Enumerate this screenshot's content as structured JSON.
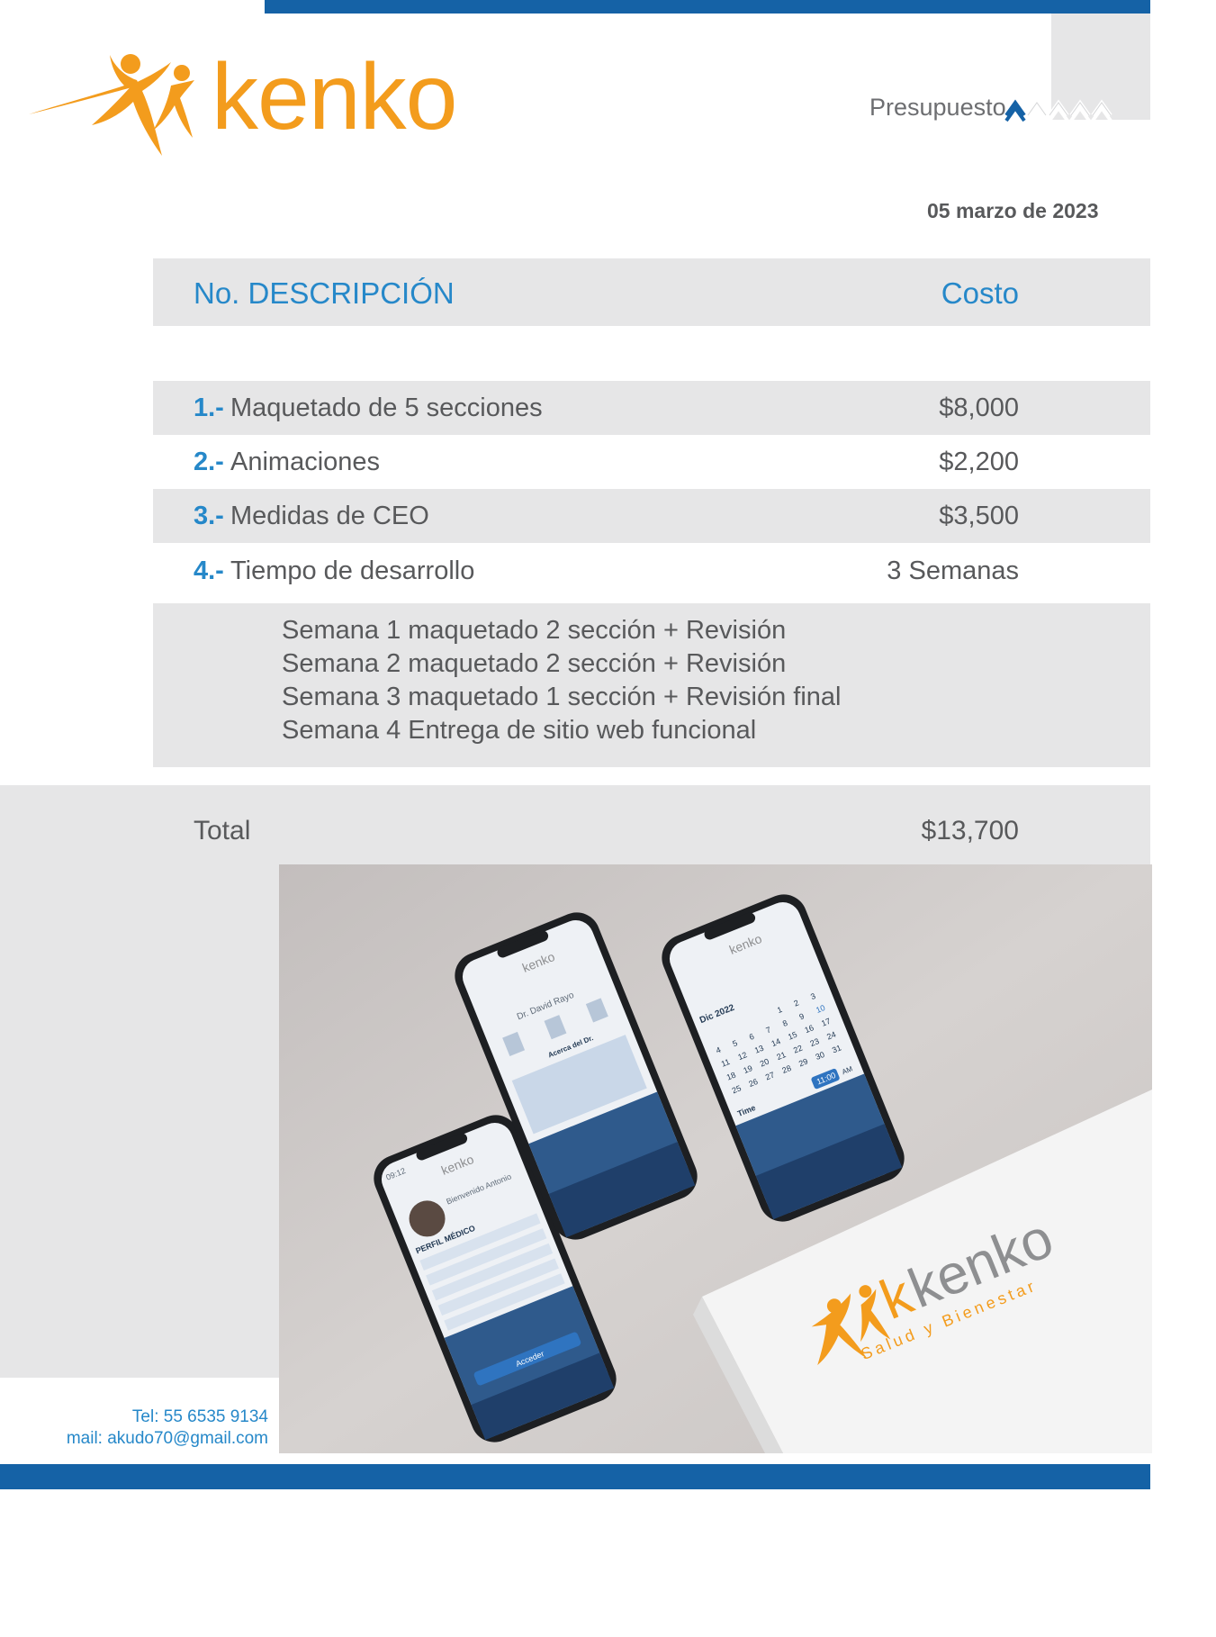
{
  "brand": {
    "name": "kenko",
    "colors": {
      "orange": "#f39c1d",
      "gray": "#8e8f91",
      "blue": "#1562a6",
      "light_blue": "#2688c9",
      "band": "#e6e6e7"
    }
  },
  "document": {
    "type_label": "Presupuesto",
    "date": "05 marzo de 2023"
  },
  "table": {
    "header_description": "No. DESCRIPCIÓN",
    "header_cost": "Costo",
    "rows": [
      {
        "num": "1.-",
        "description": "Maquetado de 5 secciones",
        "cost": "$8,000"
      },
      {
        "num": "2.-",
        "description": "Animaciones",
        "cost": "$2,200"
      },
      {
        "num": "3.-",
        "description": "Medidas de CEO",
        "cost": "$3,500"
      },
      {
        "num": "4.-",
        "description": "Tiempo de desarrollo",
        "cost": "3 Semanas"
      }
    ],
    "schedule": [
      "Semana 1 maquetado 2 sección + Revisión",
      "Semana 2 maquetado 2 sección + Revisión",
      "Semana 3 maquetado 1 sección + Revisión final",
      "Semana 4 Entrega de sitio web funcional"
    ],
    "total_label": "Total",
    "total_value": "$13,700"
  },
  "contact": {
    "phone": "Tel: 55 6535 9134",
    "email": "mail: akudo70@gmail.com"
  },
  "mockup": {
    "box_brand": "kenko",
    "box_tagline": "Salud y Bienestar",
    "phone_brand": "kenko",
    "phone1_time": "09:12",
    "phone1_greeting": "Bienvenido Antonio",
    "phone1_section": "PERFIL MÉDICO",
    "phone1_button": "Acceder",
    "phone2_doctor": "Dr. David Rayo",
    "phone2_section": "Acerca del Dr.",
    "phone3_month": "Dic 2022",
    "phone3_time_label": "Time",
    "phone3_time_value": "11:00",
    "phone3_ampm": "AM",
    "calendar_days": [
      "1",
      "2",
      "3",
      "4",
      "5",
      "6",
      "7",
      "8",
      "9",
      "10",
      "11",
      "12",
      "13",
      "14",
      "15",
      "16",
      "17",
      "18",
      "19",
      "20",
      "21",
      "22",
      "23",
      "24",
      "25",
      "26",
      "27",
      "28",
      "29",
      "30",
      "31"
    ]
  }
}
